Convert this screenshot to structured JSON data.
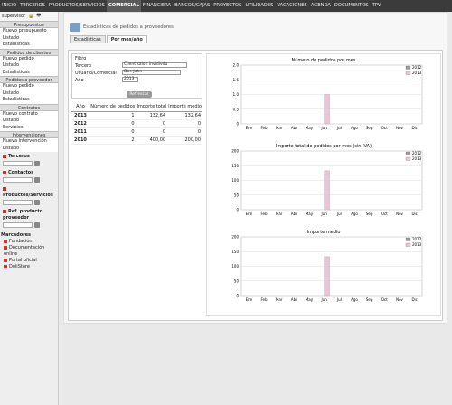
{
  "topnav": {
    "items": [
      "INICIO",
      "TERCEROS",
      "PRODUCTOS/SERVICIOS",
      "COMERCIAL",
      "FINANCIERA",
      "BANCOS/CAJAS",
      "PROYECTOS",
      "UTILIDADES",
      "VACACIONES",
      "AGENDA",
      "DOCUMENTOS",
      "TPV"
    ],
    "active": "COMERCIAL"
  },
  "user": {
    "name": "supervisor"
  },
  "menu": [
    {
      "title": "Presupuestos",
      "items": [
        "Nuevo presupuesto",
        "Listado",
        "Estadisticas"
      ]
    },
    {
      "title": "Pedidos de clientes",
      "items": [
        "Nuevo pedido",
        "Listado",
        "Estadisticas"
      ]
    },
    {
      "title": "Pedidos a proveedor",
      "items": [
        "Nuevo pedido",
        "Listado",
        "Estadisticas"
      ]
    },
    {
      "title": "Contratos",
      "items": [
        "Nuevo contrato",
        "Listado",
        "Servicios"
      ]
    },
    {
      "title": "Intervenciones",
      "items": [
        "Nueva intervención",
        "Listado"
      ]
    }
  ],
  "search": {
    "terceros": "Terceros",
    "contactos": "Contactos",
    "productos": "Productos/Servicios",
    "refprov": "Ref. producto proveedor"
  },
  "bookmarks": {
    "title": "Marcadores",
    "items": [
      "Fundación",
      "Documentación online",
      "Portal oficial",
      "DoliStore"
    ]
  },
  "page": {
    "title": "Estadísticas de pedidos a proveedores",
    "tabs": [
      "Estadísticas",
      "Por mes/año"
    ],
    "active_tab": "Por mes/año"
  },
  "filter": {
    "title": "Filtro",
    "tercero_label": "Tercero",
    "tercero_value": "Client salon invidivdu",
    "user_label": "Usuario/Comercial",
    "user_value": "Doe John",
    "year_label": "Año",
    "year_value": "2013",
    "refresh": "Refrescar"
  },
  "table": {
    "headers": [
      "Año",
      "Número de pedidos",
      "Importe total",
      "Importe medio"
    ],
    "rows": [
      [
        "2013",
        "1",
        "132,64",
        "132,64"
      ],
      [
        "2012",
        "0",
        "0",
        "0"
      ],
      [
        "2011",
        "0",
        "0",
        "0"
      ],
      [
        "2010",
        "2",
        "400,00",
        "200,00"
      ]
    ]
  },
  "chart_data": [
    {
      "type": "bar",
      "title": "Número de pedidos por mes",
      "categories": [
        "Ene",
        "Feb",
        "Mar",
        "Abr",
        "May",
        "Jun",
        "Jul",
        "Ago",
        "Sep",
        "Oct",
        "Nov",
        "Dic"
      ],
      "series": [
        {
          "name": "2012",
          "values": [
            0,
            0,
            0,
            0,
            0,
            0,
            0,
            0,
            0,
            0,
            0,
            0
          ]
        },
        {
          "name": "2013",
          "values": [
            0,
            0,
            0,
            0,
            0,
            1,
            0,
            0,
            0,
            0,
            0,
            0
          ]
        }
      ],
      "ylim": [
        0,
        2
      ],
      "yticks": [
        "0",
        "0.5",
        "1.0",
        "1.5",
        "2.0"
      ],
      "legend": "top-right",
      "colors": [
        "#999999",
        "#e6c7d6"
      ]
    },
    {
      "type": "bar",
      "title": "Importe total de pedidos por mes (sin IVA)",
      "categories": [
        "Ene",
        "Feb",
        "Mar",
        "Abr",
        "May",
        "Jun",
        "Jul",
        "Ago",
        "Sep",
        "Oct",
        "Nov",
        "Dic"
      ],
      "series": [
        {
          "name": "2012",
          "values": [
            0,
            0,
            0,
            0,
            0,
            0,
            0,
            0,
            0,
            0,
            0,
            0
          ]
        },
        {
          "name": "2013",
          "values": [
            0,
            0,
            0,
            0,
            0,
            132.64,
            0,
            0,
            0,
            0,
            0,
            0
          ]
        }
      ],
      "ylim": [
        0,
        200
      ],
      "yticks": [
        "0",
        "50",
        "100",
        "150",
        "200"
      ],
      "legend": "top-right",
      "colors": [
        "#999999",
        "#e6c7d6"
      ]
    },
    {
      "type": "bar",
      "title": "Importe medio",
      "categories": [
        "Ene",
        "Feb",
        "Mar",
        "Abr",
        "May",
        "Jun",
        "Jul",
        "Ago",
        "Sep",
        "Oct",
        "Nov",
        "Dic"
      ],
      "series": [
        {
          "name": "2012",
          "values": [
            0,
            0,
            0,
            0,
            0,
            0,
            0,
            0,
            0,
            0,
            0,
            0
          ]
        },
        {
          "name": "2013",
          "values": [
            0,
            0,
            0,
            0,
            0,
            132.64,
            0,
            0,
            0,
            0,
            0,
            0
          ]
        }
      ],
      "ylim": [
        0,
        200
      ],
      "yticks": [
        "0",
        "50",
        "100",
        "150",
        "200"
      ],
      "legend": "top-right",
      "colors": [
        "#999999",
        "#e6c7d6"
      ]
    }
  ]
}
